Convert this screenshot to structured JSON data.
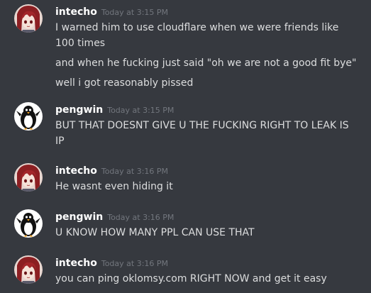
{
  "messages": [
    {
      "username": "intecho",
      "timestamp": "Today at 3:15 PM",
      "avatar": "anime-girl-avatar",
      "lines": [
        "I warned him to use cloudflare when we were friends like 100 times",
        "and when he fucking just said \"oh we are not a good fit bye\"",
        "well i got reasonably pissed"
      ]
    },
    {
      "username": "pengwin",
      "timestamp": "Today at 3:15 PM",
      "avatar": "penguin-avatar",
      "lines": [
        "BUT THAT DOESNT GIVE U THE FUCKING RIGHT TO LEAK IS IP"
      ]
    },
    {
      "username": "intecho",
      "timestamp": "Today at 3:16 PM",
      "avatar": "anime-girl-avatar",
      "lines": [
        "He wasnt even hiding it"
      ]
    },
    {
      "username": "pengwin",
      "timestamp": "Today at 3:16 PM",
      "avatar": "penguin-avatar",
      "lines": [
        "U KNOW HOW MANY PPL CAN USE THAT"
      ]
    },
    {
      "username": "intecho",
      "timestamp": "Today at 3:16 PM",
      "avatar": "anime-girl-avatar",
      "lines": [
        "you can ping oklomsy.com RIGHT NOW and get it easy"
      ]
    }
  ],
  "colors": {
    "background": "#36393f",
    "username": "#ffffff",
    "timestamp": "#72767d",
    "message_text": "#dcddde"
  }
}
